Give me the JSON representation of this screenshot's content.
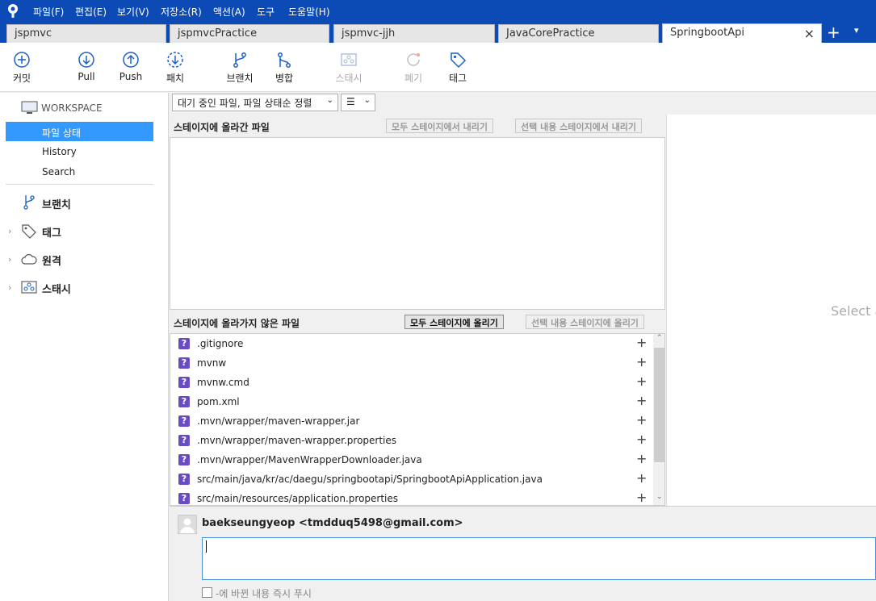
{
  "menu": [
    "파일(F)",
    "편집(E)",
    "보기(V)",
    "저장소(R)",
    "액션(A)",
    "도구",
    "도움말(H)"
  ],
  "tabs": [
    "jspmvc",
    "jspmvcPractice",
    "jspmvc-jjh",
    "JavaCorePractice",
    "SpringbootApi"
  ],
  "tab_close": "×",
  "tab_add": "+",
  "tab_menu": "▾",
  "toolbar": {
    "commit": "커밋",
    "pull": "Pull",
    "push": "Push",
    "patch": "패치",
    "branch": "브랜치",
    "merge": "병합",
    "stash": "스태시",
    "discard": "폐기",
    "tag": "태그"
  },
  "sidebar": {
    "workspace": "WORKSPACE",
    "file_status": "파일 상태",
    "history": "History",
    "search": "Search",
    "branches": "브랜치",
    "tags": "태그",
    "remotes": "원격",
    "stashes": "스태시"
  },
  "filter": {
    "sort": "대기 중인 파일, 파일 상태순 정렬",
    "view": "☰"
  },
  "staged": {
    "title": "스테이지에 올라간 파일",
    "unstage_all": "모두 스테이지에서 내리기",
    "unstage_selected": "선택 내용 스테이지에서 내리기"
  },
  "unstaged": {
    "title": "스테이지에 올라가지 않은 파일",
    "stage_all": "모두 스테이지에 올리기",
    "stage_selected": "선택 내용 스테이지에 올리기",
    "files": [
      ".gitignore",
      "mvnw",
      "mvnw.cmd",
      "pom.xml",
      ".mvn/wrapper/maven-wrapper.jar",
      ".mvn/wrapper/maven-wrapper.properties",
      ".mvn/wrapper/MavenWrapperDownloader.java",
      "src/main/java/kr/ac/daegu/springbootapi/SpringbootApiApplication.java",
      "src/main/resources/application.properties"
    ]
  },
  "right_panel": {
    "placeholder": "Select a"
  },
  "commit": {
    "author": "baekseungyeop <tmdduq5498@gmail.com>",
    "push_option": "-에 바뀐 내용 즉시 푸시"
  },
  "colors": {
    "accent": "#0c4bb5",
    "selection": "#3399ff",
    "untracked": "#6a4bc4"
  }
}
